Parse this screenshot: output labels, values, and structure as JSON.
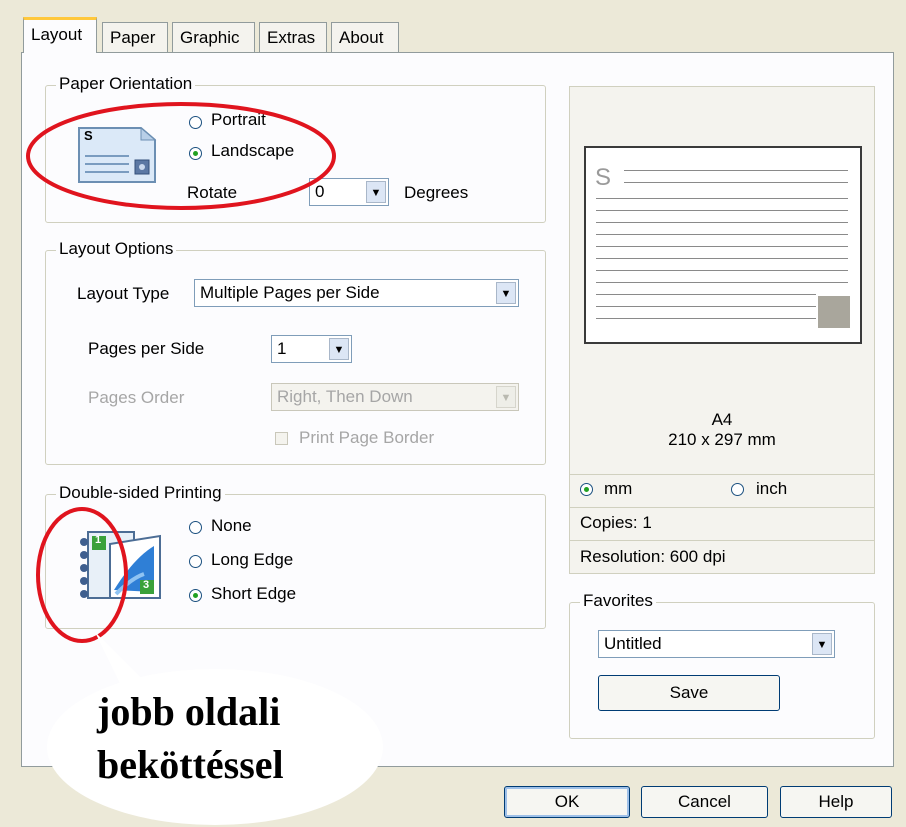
{
  "tabs": [
    "Layout",
    "Paper",
    "Graphic",
    "Extras",
    "About"
  ],
  "orientation": {
    "title": "Paper Orientation",
    "portrait": "Portrait",
    "landscape": "Landscape",
    "rotate_label": "Rotate",
    "rotate_value": "0",
    "degrees": "Degrees",
    "icon_letter": "S"
  },
  "layout_options": {
    "title": "Layout Options",
    "type_label": "Layout Type",
    "type_value": "Multiple Pages per Side",
    "pps_label": "Pages per Side",
    "pps_value": "1",
    "order_label": "Pages Order",
    "order_value": "Right, Then Down",
    "border_label": "Print Page Border"
  },
  "duplex": {
    "title": "Double-sided Printing",
    "none": "None",
    "long": "Long Edge",
    "short": "Short Edge",
    "icon_page_1": "1",
    "icon_page_3": "3"
  },
  "preview": {
    "letter": "S",
    "paper": "A4",
    "size": "210 x 297 mm",
    "mm": "mm",
    "inch": "inch",
    "copies": "Copies: 1",
    "resolution": "Resolution: 600 dpi"
  },
  "favorites": {
    "title": "Favorites",
    "value": "Untitled",
    "save": "Save"
  },
  "buttons": {
    "ok": "OK",
    "cancel": "Cancel",
    "help": "Help"
  },
  "callout": {
    "line1": "jobb oldali",
    "line2": "beköttéssel"
  },
  "colors": {
    "annotation": "#e0141e",
    "accent_tab": "#ffc83c",
    "radio_dot": "#21a121"
  }
}
